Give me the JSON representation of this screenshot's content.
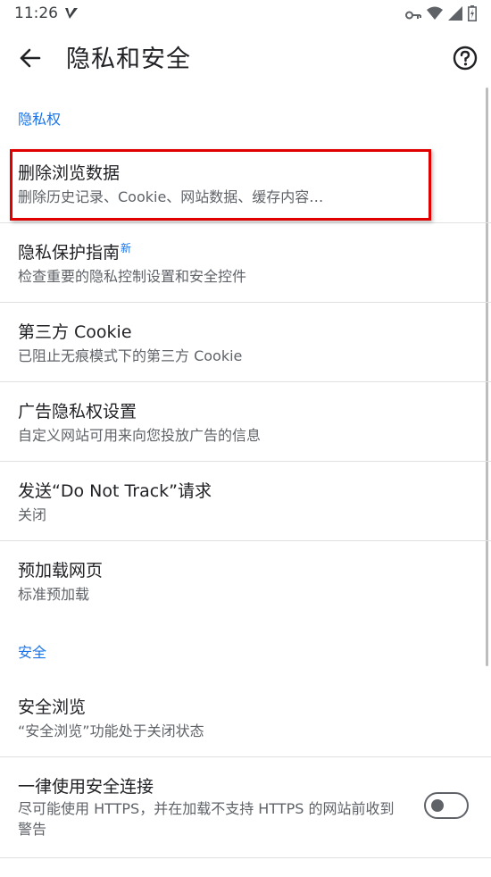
{
  "status_bar": {
    "time": "11:26"
  },
  "toolbar": {
    "title": "隐私和安全"
  },
  "sections": {
    "privacy": {
      "header": "隐私权"
    },
    "security": {
      "header": "安全"
    }
  },
  "items": {
    "clear_data": {
      "title": "删除浏览数据",
      "subtitle": "删除历史记录、Cookie、网站数据、缓存内容…"
    },
    "privacy_guide": {
      "title": "隐私保护指南",
      "badge": "新",
      "subtitle": "检查重要的隐私控制设置和安全控件"
    },
    "third_party_cookie": {
      "title": "第三方 Cookie",
      "subtitle": "已阻止无痕模式下的第三方 Cookie"
    },
    "ad_privacy": {
      "title": "广告隐私权设置",
      "subtitle": "自定义网站可用来向您投放广告的信息"
    },
    "do_not_track": {
      "title": "发送“Do Not Track”请求",
      "subtitle": "关闭"
    },
    "preload": {
      "title": "预加载网页",
      "subtitle": "标准预加载"
    },
    "safe_browsing": {
      "title": "安全浏览",
      "subtitle": "“安全浏览”功能处于关闭状态"
    },
    "https_only": {
      "title": "一律使用安全连接",
      "subtitle": "尽可能使用 HTTPS，并在加载不支持 HTTPS 的网站前收到警告",
      "toggle_on": false
    }
  },
  "colors": {
    "accent": "#1a73e8",
    "highlight_box": "#e00000"
  }
}
